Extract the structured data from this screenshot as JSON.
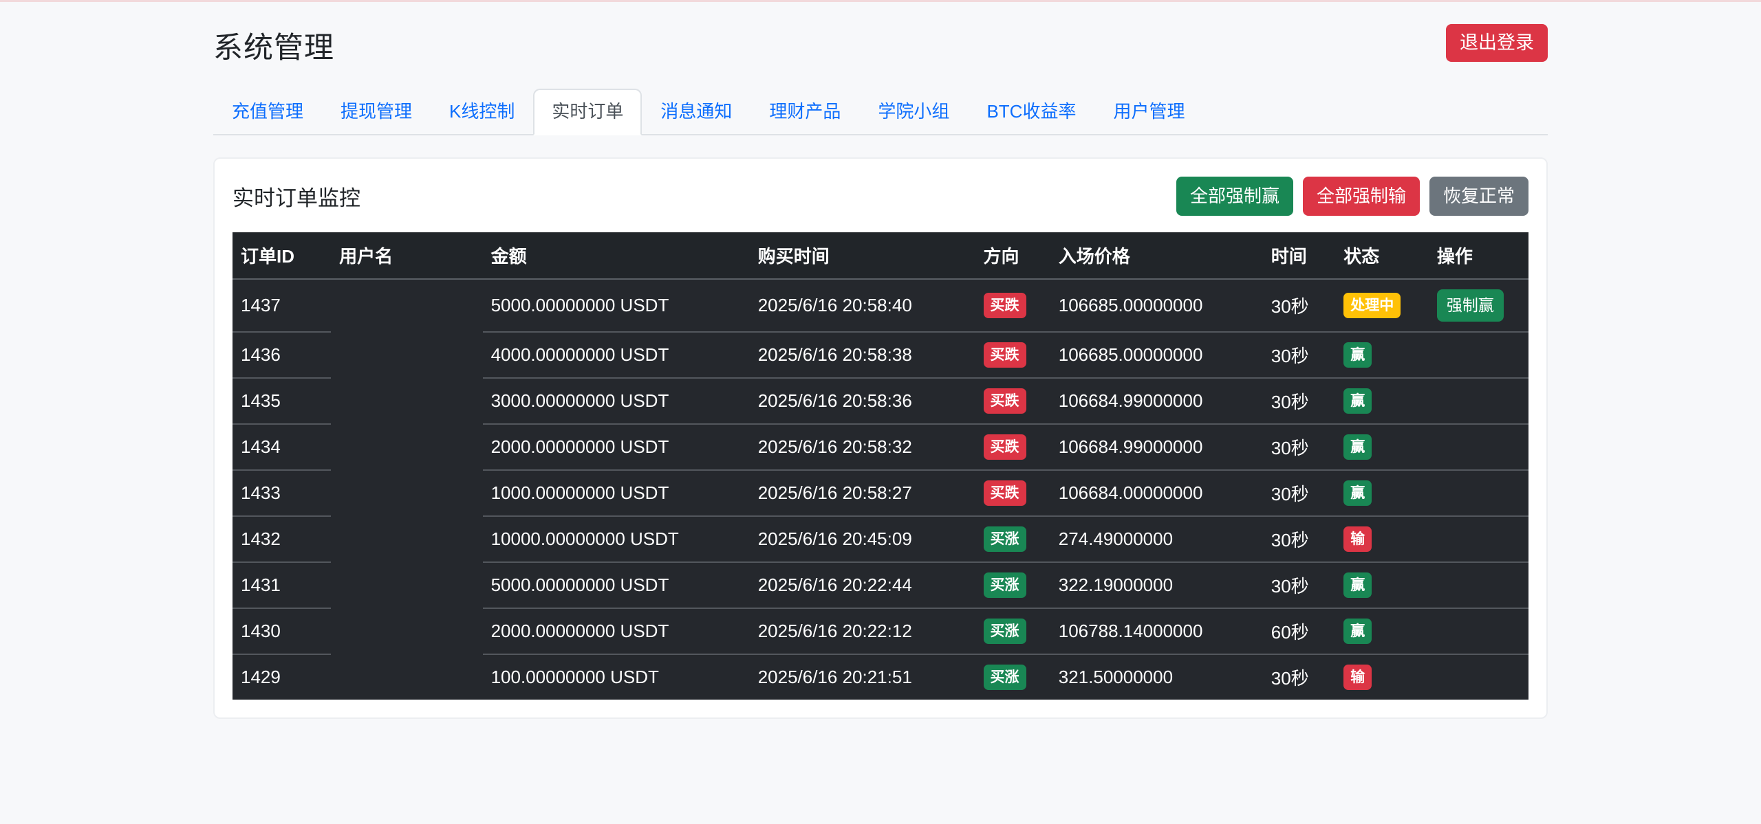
{
  "page": {
    "title": "系统管理",
    "logout_label": "退出登录"
  },
  "tabs": [
    {
      "key": "recharge",
      "label": "充值管理",
      "active": false
    },
    {
      "key": "withdraw",
      "label": "提现管理",
      "active": false
    },
    {
      "key": "kline-control",
      "label": "K线控制",
      "active": false
    },
    {
      "key": "realtime-orders",
      "label": "实时订单",
      "active": true
    },
    {
      "key": "notifications",
      "label": "消息通知",
      "active": false
    },
    {
      "key": "wealth-products",
      "label": "理财产品",
      "active": false
    },
    {
      "key": "academy-groups",
      "label": "学院小组",
      "active": false
    },
    {
      "key": "btc-yield",
      "label": "BTC收益率",
      "active": false
    },
    {
      "key": "users",
      "label": "用户管理",
      "active": false
    }
  ],
  "panel": {
    "title": "实时订单监控",
    "buttons": [
      {
        "key": "force-win-all",
        "label": "全部强制赢",
        "color": "green"
      },
      {
        "key": "force-lose-all",
        "label": "全部强制输",
        "color": "red"
      },
      {
        "key": "restore-normal",
        "label": "恢复正常",
        "color": "gray"
      }
    ]
  },
  "table": {
    "headers": [
      "订单ID",
      "用户名",
      "金额",
      "购买时间",
      "方向",
      "入场价格",
      "时间",
      "状态",
      "操作"
    ],
    "rows": [
      {
        "id": "1437",
        "username": "",
        "amount": "5000.00000000 USDT",
        "purchase_time": "2025/6/16 20:58:40",
        "direction": "买跌",
        "direction_type": "down",
        "price": "106685.00000000",
        "duration": "30秒",
        "status": "处理中",
        "status_type": "processing",
        "action": "强制赢"
      },
      {
        "id": "1436",
        "username": "",
        "amount": "4000.00000000 USDT",
        "purchase_time": "2025/6/16 20:58:38",
        "direction": "买跌",
        "direction_type": "down",
        "price": "106685.00000000",
        "duration": "30秒",
        "status": "赢",
        "status_type": "win",
        "action": ""
      },
      {
        "id": "1435",
        "username": "",
        "amount": "3000.00000000 USDT",
        "purchase_time": "2025/6/16 20:58:36",
        "direction": "买跌",
        "direction_type": "down",
        "price": "106684.99000000",
        "duration": "30秒",
        "status": "赢",
        "status_type": "win",
        "action": ""
      },
      {
        "id": "1434",
        "username": "",
        "amount": "2000.00000000 USDT",
        "purchase_time": "2025/6/16 20:58:32",
        "direction": "买跌",
        "direction_type": "down",
        "price": "106684.99000000",
        "duration": "30秒",
        "status": "赢",
        "status_type": "win",
        "action": ""
      },
      {
        "id": "1433",
        "username": "",
        "amount": "1000.00000000 USDT",
        "purchase_time": "2025/6/16 20:58:27",
        "direction": "买跌",
        "direction_type": "down",
        "price": "106684.00000000",
        "duration": "30秒",
        "status": "赢",
        "status_type": "win",
        "action": ""
      },
      {
        "id": "1432",
        "username": "",
        "amount": "10000.00000000 USDT",
        "purchase_time": "2025/6/16 20:45:09",
        "direction": "买涨",
        "direction_type": "up",
        "price": "274.49000000",
        "duration": "30秒",
        "status": "输",
        "status_type": "lose",
        "action": ""
      },
      {
        "id": "1431",
        "username": "",
        "amount": "5000.00000000 USDT",
        "purchase_time": "2025/6/16 20:22:44",
        "direction": "买涨",
        "direction_type": "up",
        "price": "322.19000000",
        "duration": "30秒",
        "status": "赢",
        "status_type": "win",
        "action": ""
      },
      {
        "id": "1430",
        "username": "",
        "amount": "2000.00000000 USDT",
        "purchase_time": "2025/6/16 20:22:12",
        "direction": "买涨",
        "direction_type": "up",
        "price": "106788.14000000",
        "duration": "60秒",
        "status": "赢",
        "status_type": "win",
        "action": ""
      },
      {
        "id": "1429",
        "username": "",
        "amount": "100.00000000 USDT",
        "purchase_time": "2025/6/16 20:21:51",
        "direction": "买涨",
        "direction_type": "up",
        "price": "321.50000000",
        "duration": "30秒",
        "status": "输",
        "status_type": "lose",
        "action": ""
      }
    ]
  },
  "colors": {
    "link_blue": "#0d6efd",
    "success_green": "#198754",
    "danger_red": "#dc3545",
    "warning_yellow": "#ffc107",
    "secondary_gray": "#6c757d",
    "table_dark": "#212529"
  }
}
